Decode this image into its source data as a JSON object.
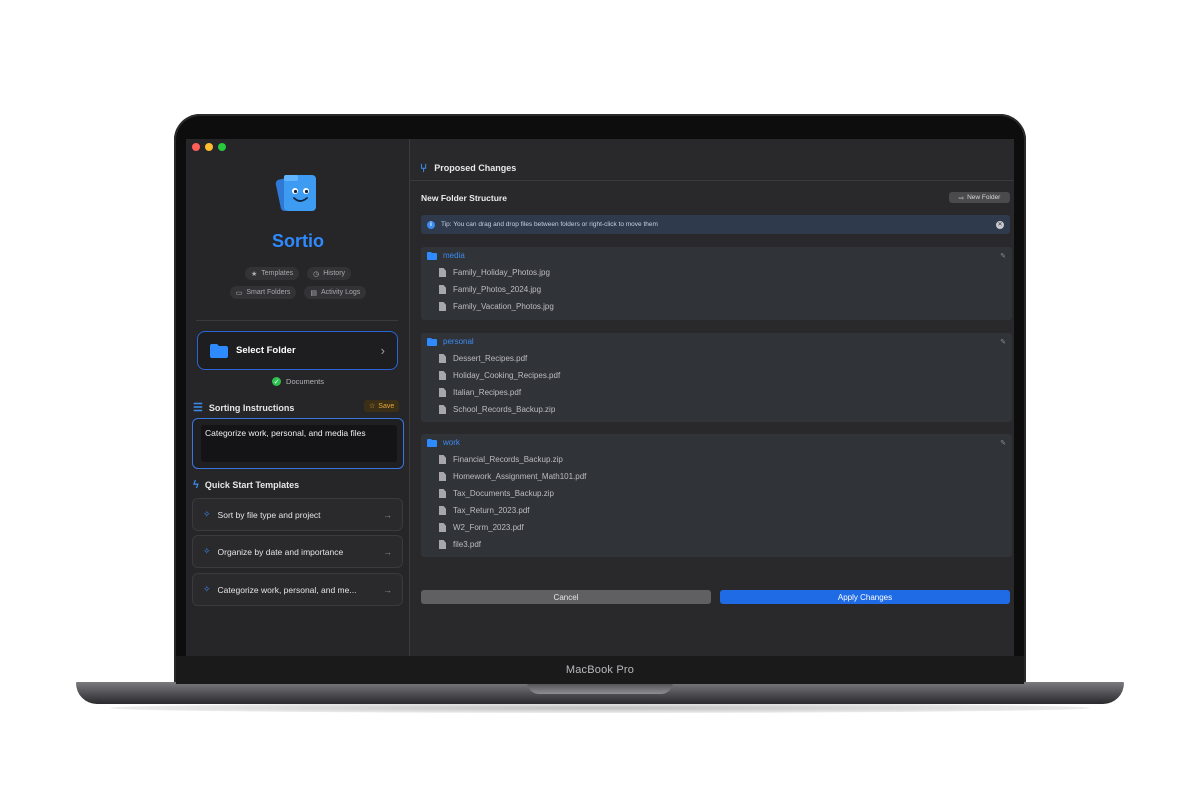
{
  "device": {
    "label": "MacBook Pro"
  },
  "app": {
    "name": "Sortio"
  },
  "nav": {
    "templates": "Templates",
    "history": "History",
    "smart_folders": "Smart Folders",
    "activity_logs": "Activity Logs"
  },
  "folder": {
    "select_label": "Select Folder",
    "selected_name": "Documents"
  },
  "instructions": {
    "title": "Sorting Instructions",
    "save_label": "Save",
    "value": "Categorize work, personal, and media files"
  },
  "templates": {
    "title": "Quick Start Templates",
    "items": [
      {
        "label": "Sort by file type and project"
      },
      {
        "label": "Organize by date and importance"
      },
      {
        "label": "Categorize work, personal, and me..."
      }
    ]
  },
  "main": {
    "title": "Proposed Changes",
    "structure_title": "New Folder Structure",
    "new_folder_label": "New Folder",
    "tip": "Tip: You can drag and drop files between folders or right-click to move them",
    "groups": [
      {
        "name": "media",
        "files": [
          "Family_Holiday_Photos.jpg",
          "Family_Photos_2024.jpg",
          "Family_Vacation_Photos.jpg"
        ]
      },
      {
        "name": "personal",
        "files": [
          "Dessert_Recipes.pdf",
          "Holiday_Cooking_Recipes.pdf",
          "Italian_Recipes.pdf",
          "School_Records_Backup.zip"
        ]
      },
      {
        "name": "work",
        "files": [
          "Financial_Records_Backup.zip",
          "Homework_Assignment_Math101.pdf",
          "Tax_Documents_Backup.zip",
          "Tax_Return_2023.pdf",
          "W2_Form_2023.pdf",
          "file3.pdf"
        ]
      }
    ],
    "cancel_label": "Cancel",
    "apply_label": "Apply Changes"
  },
  "colors": {
    "accent": "#2e8bff",
    "apply": "#1f6be6",
    "save": "#e7a93a",
    "ok": "#30c04f"
  },
  "icons": [
    "star-icon",
    "clock-icon",
    "folder-icon",
    "clipboard-icon",
    "chevron-right-icon",
    "checkmark-icon",
    "list-icon",
    "lightning-icon",
    "sparkle-icon",
    "arrow-right-icon",
    "fork-icon",
    "info-icon",
    "close-icon",
    "pencil-icon",
    "file-icon"
  ]
}
